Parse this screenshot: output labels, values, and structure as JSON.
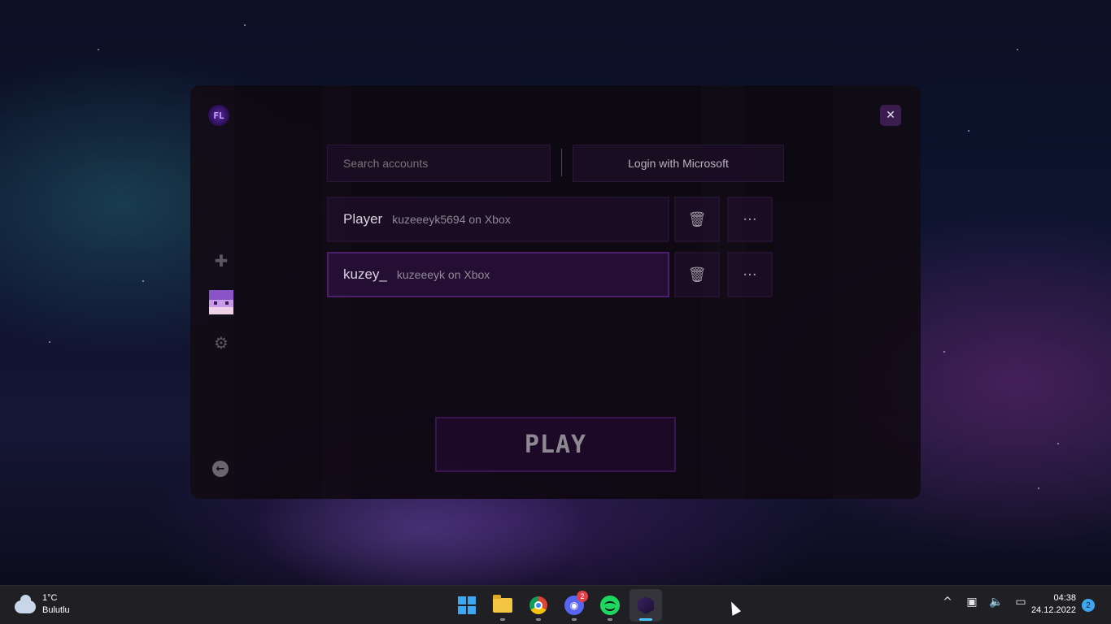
{
  "launcher": {
    "logo_text": "FL",
    "close_icon": "close-icon",
    "search": {
      "placeholder": "Search accounts"
    },
    "login_button": "Login with Microsoft",
    "accounts": [
      {
        "name": "Player",
        "detail": "kuzeeeyk5694 on Xbox",
        "selected": false
      },
      {
        "name": "kuzey_",
        "detail": "kuzeeeyk on Xbox",
        "selected": true
      }
    ],
    "delete_icon": "trash-icon",
    "more_label": "···",
    "play_label": "PLAY",
    "sidebar": {
      "icons": [
        "puzzle-icon",
        "avatar",
        "gear-icon",
        "back-arrow-icon"
      ]
    }
  },
  "taskbar": {
    "weather": {
      "temp": "1°C",
      "condition": "Bulutlu"
    },
    "apps": [
      "start",
      "file-explorer",
      "chrome",
      "discord",
      "spotify",
      "minecraft-launcher"
    ],
    "discord_badge": "2",
    "clock": {
      "time": "04:38",
      "date": "24.12.2022"
    },
    "notification_count": "2",
    "tray_chevron": "^"
  },
  "colors": {
    "accent": "#4c1f6a",
    "window_bg": "#0e0911",
    "taskbar_bg": "#202024"
  }
}
